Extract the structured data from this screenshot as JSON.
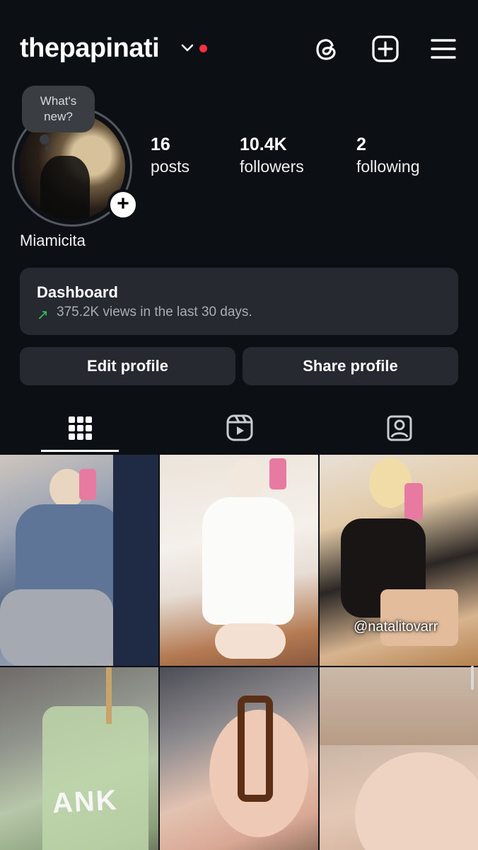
{
  "header": {
    "username": "thepapinati",
    "icons": [
      "threads-icon",
      "create-post-icon",
      "menu-icon"
    ]
  },
  "note_bubble": {
    "text_line1": "What's",
    "text_line2": "new?"
  },
  "stats": {
    "posts": {
      "value": "16",
      "label": "posts"
    },
    "followers": {
      "value": "10.4K",
      "label": "followers"
    },
    "following": {
      "value": "2",
      "label": "following"
    }
  },
  "profile": {
    "display_name": "Miamicita"
  },
  "dashboard": {
    "title": "Dashboard",
    "trend_icon": "↗",
    "subtitle": "375.2K views in the last 30 days."
  },
  "buttons": {
    "edit_profile": "Edit profile",
    "share_profile": "Share profile"
  },
  "tabs": [
    "grid-icon",
    "reels-icon",
    "tagged-icon"
  ],
  "grid": {
    "posts": [
      {
        "overlay": ""
      },
      {
        "overlay": ""
      },
      {
        "overlay": "@natalitovarr"
      },
      {
        "overlay": "ANK"
      },
      {
        "overlay": ""
      },
      {
        "overlay": ""
      }
    ]
  },
  "colors": {
    "background": "#0c0f14",
    "card": "#262a30",
    "notification": "#ff3040",
    "trend": "#36c160"
  }
}
